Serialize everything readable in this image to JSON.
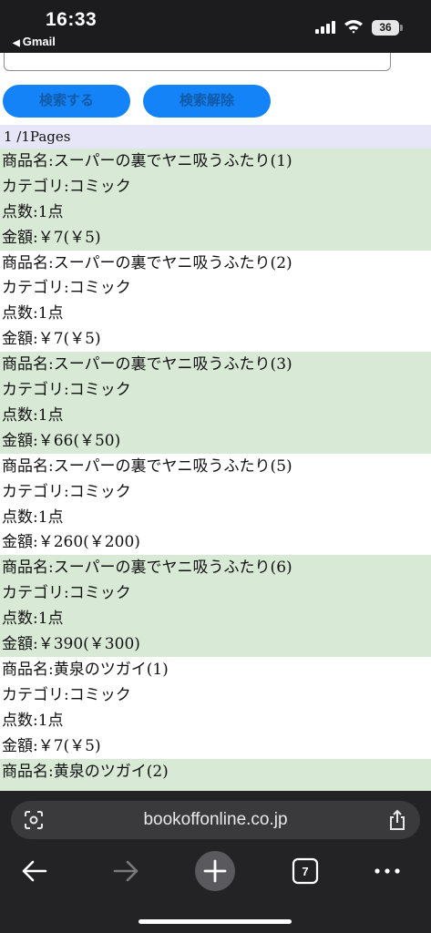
{
  "status_bar": {
    "time": "16:33",
    "back_app": "Gmail",
    "battery": "36"
  },
  "search": {
    "value": "",
    "search_button": "検索する",
    "clear_button": "検索解除",
    "button_color": "#1483f7"
  },
  "pagination": "1 /1Pages",
  "items": [
    {
      "name": "商品名:スーパーの裏でヤニ吸うふたり(1)",
      "category": "カテゴリ:コミック",
      "count": "点数:1点",
      "price": "金額:￥7(￥5)"
    },
    {
      "name": "商品名:スーパーの裏でヤニ吸うふたり(2)",
      "category": "カテゴリ:コミック",
      "count": "点数:1点",
      "price": "金額:￥7(￥5)"
    },
    {
      "name": "商品名:スーパーの裏でヤニ吸うふたり(3)",
      "category": "カテゴリ:コミック",
      "count": "点数:1点",
      "price": "金額:￥66(￥50)"
    },
    {
      "name": "商品名:スーパーの裏でヤニ吸うふたり(5)",
      "category": "カテゴリ:コミック",
      "count": "点数:1点",
      "price": "金額:￥260(￥200)"
    },
    {
      "name": "商品名:スーパーの裏でヤニ吸うふたり(6)",
      "category": "カテゴリ:コミック",
      "count": "点数:1点",
      "price": "金額:￥390(￥300)"
    },
    {
      "name": "商品名:黄泉のツガイ(1)",
      "category": "カテゴリ:コミック",
      "count": "点数:1点",
      "price": "金額:￥7(￥5)"
    },
    {
      "name": "商品名:黄泉のツガイ(2)",
      "category": "",
      "count": "",
      "price": ""
    }
  ],
  "browser": {
    "url": "bookoffonline.co.jp",
    "tab_count": "7",
    "icons": [
      "lens-icon",
      "share-icon",
      "back-arrow-icon",
      "forward-arrow-icon",
      "new-tab-plus-icon",
      "tabs-icon",
      "more-icon"
    ]
  }
}
